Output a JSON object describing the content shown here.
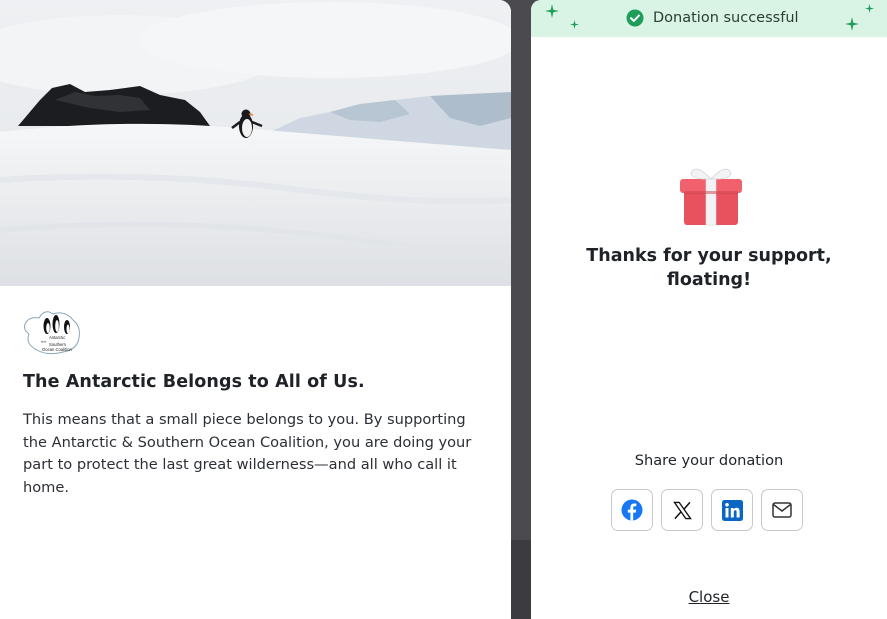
{
  "campaign": {
    "title": "The Antarctic Belongs to All of Us.",
    "description": "This means that a small piece belongs to you. By supporting the Antarctic & Southern Ocean Coalition, you are doing your part to protect the last great wilderness—and all who call it home.",
    "logo": {
      "icon": "penguins-logo",
      "text_lines": [
        "Antarctic",
        "and",
        "Southern",
        "Ocean Coalition"
      ]
    },
    "hero_image": "antarctic-snowfield-with-penguin"
  },
  "confirmation": {
    "banner_text": "Donation successful",
    "banner_icon": "check-circle-icon",
    "banner_color": "#d9f3e4",
    "accent_color": "#1f9d5a",
    "gift_icon": "gift-icon",
    "thanks_message": "Thanks for your support, floating!",
    "share_label": "Share your donation",
    "share_buttons": [
      {
        "name": "facebook",
        "icon": "facebook-icon",
        "color": "#1877f2"
      },
      {
        "name": "x",
        "icon": "x-icon",
        "color": "#000000"
      },
      {
        "name": "linkedin",
        "icon": "linkedin-icon",
        "color": "#0a66c2"
      },
      {
        "name": "email",
        "icon": "mail-icon",
        "color": "#333333"
      }
    ],
    "close_label": "Close"
  }
}
